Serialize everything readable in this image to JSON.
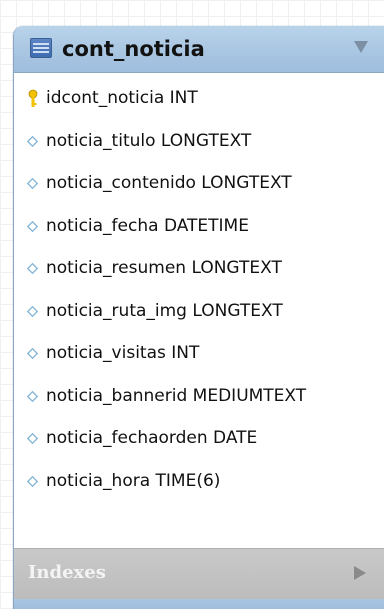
{
  "table": {
    "name": "cont_noticia",
    "columns": [
      {
        "label": "idcont_noticia INT",
        "key": "primary"
      },
      {
        "label": "noticia_titulo LONGTEXT",
        "key": "none"
      },
      {
        "label": "noticia_contenido LONGTEXT",
        "key": "none"
      },
      {
        "label": "noticia_fecha DATETIME",
        "key": "none"
      },
      {
        "label": "noticia_resumen LONGTEXT",
        "key": "none"
      },
      {
        "label": "noticia_ruta_img LONGTEXT",
        "key": "none"
      },
      {
        "label": "noticia_visitas INT",
        "key": "none"
      },
      {
        "label": "noticia_bannerid MEDIUMTEXT",
        "key": "none"
      },
      {
        "label": "noticia_fechaorden DATE",
        "key": "none"
      },
      {
        "label": "noticia_hora TIME(6)",
        "key": "none"
      }
    ]
  },
  "indexes": {
    "label": "Indexes"
  },
  "colors": {
    "header_blue": "#a9c6e2",
    "key_yellow": "#f2c200",
    "diamond_blue": "#7fb3d6",
    "indexes_gray": "#bcbcbc"
  },
  "icons": {
    "table": "table-icon",
    "collapse": "chevron-down-icon",
    "primary_key": "key-icon",
    "column": "diamond-icon",
    "expand": "chevron-right-icon"
  }
}
